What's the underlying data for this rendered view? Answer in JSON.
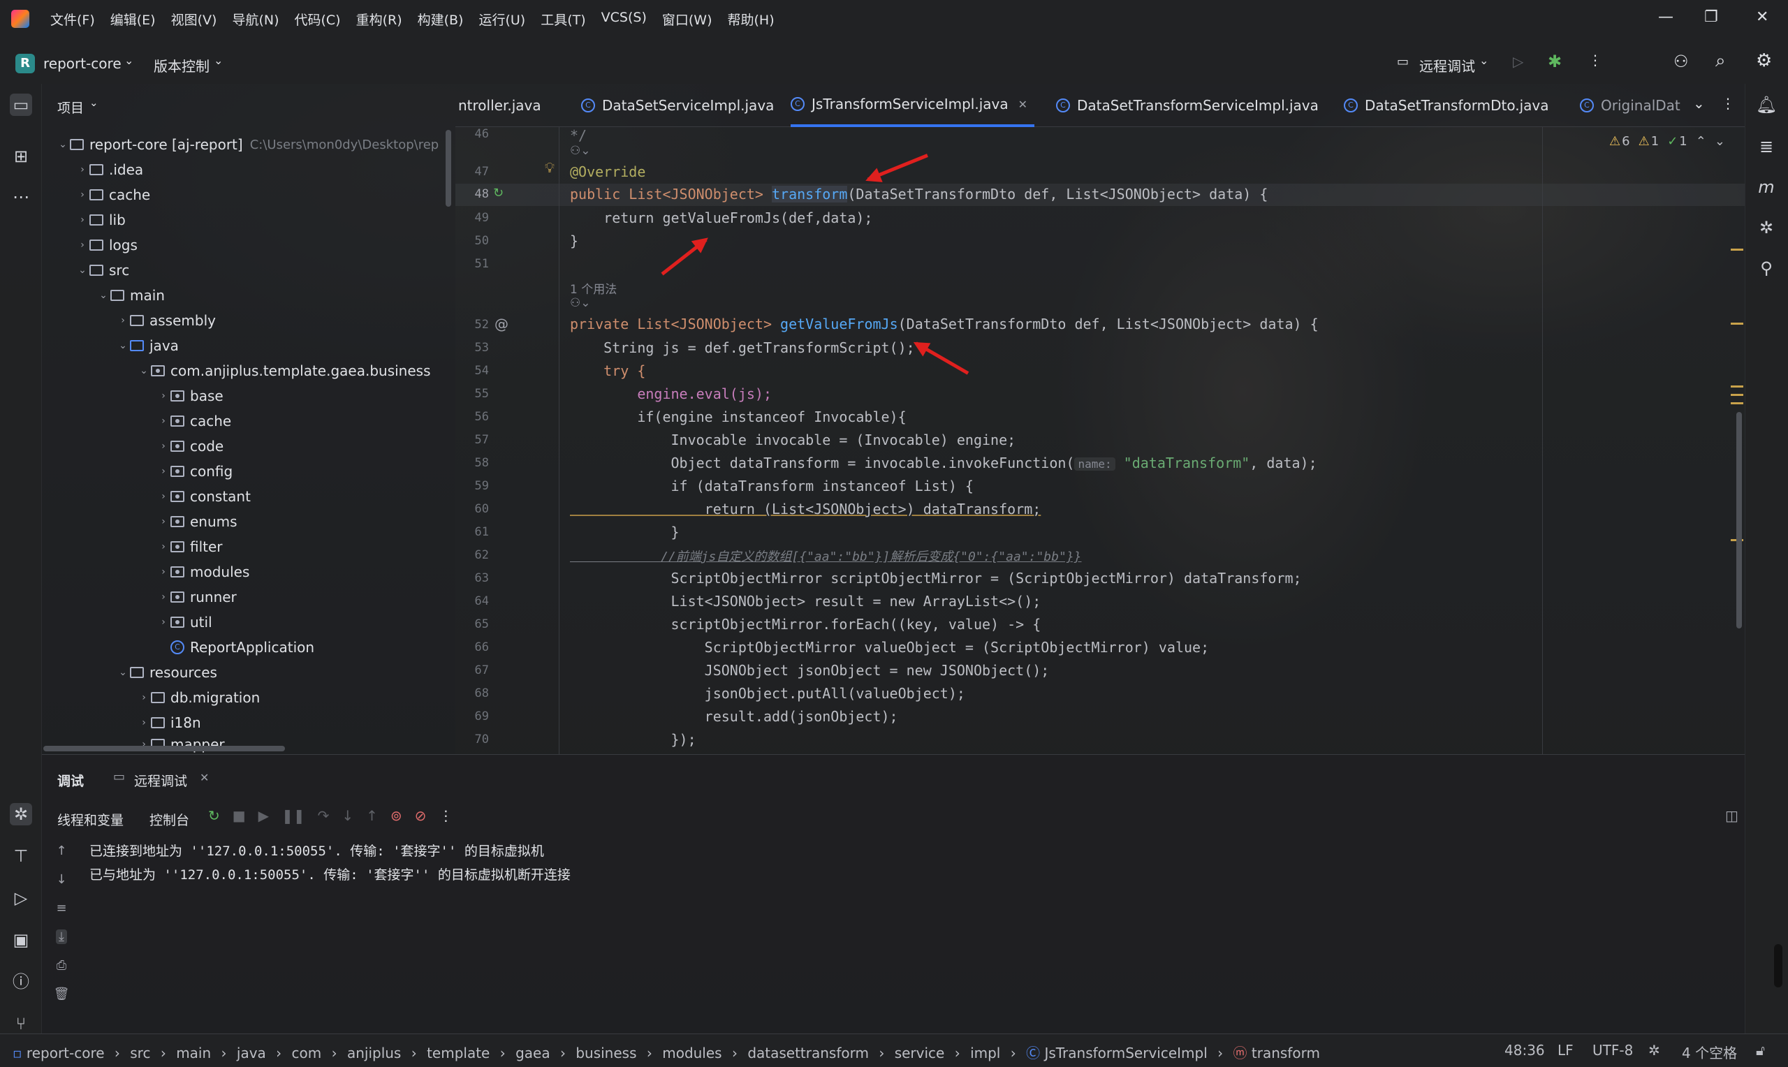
{
  "menu": [
    "文件(F)",
    "编辑(E)",
    "视图(V)",
    "导航(N)",
    "代码(C)",
    "重构(R)",
    "构建(B)",
    "运行(U)",
    "工具(T)",
    "VCS(S)",
    "窗口(W)",
    "帮助(H)"
  ],
  "toolbar": {
    "project_letter": "R",
    "project": "report-core",
    "vcs": "版本控制",
    "run_config": "远程调试"
  },
  "project_panel": {
    "title": "项目",
    "root_name": "report-core [aj-report]",
    "root_path": "C:\\Users\\mon0dy\\Desktop\\rep",
    "items": [
      ".idea",
      "cache",
      "lib",
      "logs",
      "src",
      "main",
      "assembly",
      "java",
      "com.anjiplus.template.gaea.business",
      "base",
      "cache",
      "code",
      "config",
      "constant",
      "enums",
      "filter",
      "modules",
      "runner",
      "util",
      "ReportApplication",
      "resources",
      "db.migration",
      "i18n",
      "mapper"
    ]
  },
  "tabs": [
    "ntroller.java",
    "DataSetServiceImpl.java",
    "JsTransformServiceImpl.java",
    "DataSetTransformServiceImpl.java",
    "DataSetTransformDto.java",
    "OriginalDat"
  ],
  "inspections": {
    "warnings": "6",
    "weak": "1",
    "ok": "1"
  },
  "editor": {
    "line_numbers": [
      "46",
      "",
      "47",
      "48",
      "49",
      "50",
      "51",
      "",
      "",
      "52",
      "53",
      "54",
      "55",
      "56",
      "57",
      "58",
      "59",
      "60",
      "61",
      "62",
      "63",
      "64",
      "65",
      "66",
      "67",
      "68",
      "69",
      "70"
    ],
    "usages": "1 个用法",
    "comment_end": "*/",
    "override": "@Override",
    "l48a": "public List<JSONObject> ",
    "l48fn": "transform",
    "l48b": "(DataSetTransformDto def, List<JSONObject> data) {",
    "l49": "    return getValueFromJs(def,data);",
    "l50": "}",
    "l52a": "private List<JSONObject> ",
    "l52fn": "getValueFromJs",
    "l52b": "(DataSetTransformDto def, List<JSONObject> data) {",
    "l53": "    String js = def.getTransformScript();",
    "l54": "    try {",
    "l55": "        engine.eval(js);",
    "l56": "        if(engine instanceof Invocable){",
    "l57": "            Invocable invocable = (Invocable) engine;",
    "l58a": "            Object dataTransform = invocable.invokeFunction(",
    "l58hint": "name:",
    "l58b": " \"dataTransform\"",
    ", data);": "",
    "l58c": ", data);",
    "l59": "            if (dataTransform instanceof List) {",
    "l60": "                return (List<JSONObject>) dataTransform;",
    "l61": "            }",
    "l62": "            //前端js自定义的数组[{\"aa\":\"bb\"}]解析后变成{\"0\":{\"aa\":\"bb\"}}",
    "l63": "            ScriptObjectMirror scriptObjectMirror = (ScriptObjectMirror) dataTransform;",
    "l64": "            List<JSONObject> result = new ArrayList<>();",
    "l65": "            scriptObjectMirror.forEach((key, value) -> {",
    "l66": "                ScriptObjectMirror valueObject = (ScriptObjectMirror) value;",
    "l67": "                JSONObject jsonObject = new JSONObject();",
    "l68": "                jsonObject.putAll(valueObject);",
    "l69": "                result.add(jsonObject);",
    "l70": "            });"
  },
  "debug": {
    "tab_debug": "调试",
    "tab_remote": "远程调试",
    "threads": "线程和变量",
    "console": "控制台",
    "lines": [
      "已连接到地址为 ''127.0.0.1:50055'. 传输: '套接字'' 的目标虚拟机",
      "已与地址为 ''127.0.0.1:50055'. 传输: '套接字'' 的目标虚拟机断开连接"
    ]
  },
  "breadcrumb": [
    "report-core",
    "src",
    "main",
    "java",
    "com",
    "anjiplus",
    "template",
    "gaea",
    "business",
    "modules",
    "datasettransform",
    "service",
    "impl",
    "JsTransformServiceImpl",
    "transform"
  ],
  "status": {
    "position": "48:36",
    "line_sep": "LF",
    "encoding": "UTF-8",
    "indent": "4 个空格"
  },
  "colors": {
    "accent": "#3574f0",
    "annotation_arrow": "#e0201e"
  }
}
